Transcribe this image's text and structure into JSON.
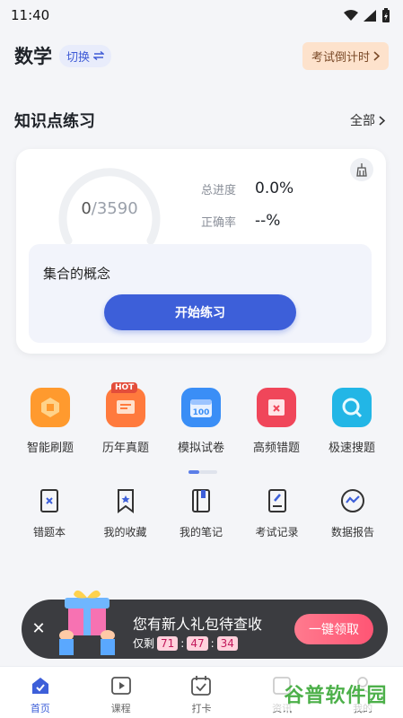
{
  "status_bar": {
    "time": "11:40"
  },
  "header": {
    "subject": "数学",
    "switch_label": "切换",
    "countdown_label": "考试倒计时"
  },
  "section": {
    "title": "知识点练习",
    "more_label": "全部"
  },
  "progress_card": {
    "done": "0",
    "total": "/3590",
    "done_fraction": 0,
    "total_progress_label": "总进度",
    "total_progress_value": "0.0%",
    "accuracy_label": "正确率",
    "accuracy_value": "--%",
    "knowledge_point": "集合的概念",
    "start_button": "开始练习"
  },
  "features": [
    {
      "label": "智能刷题",
      "icon": "smart-practice-icon",
      "color": "#ff9a2e"
    },
    {
      "label": "历年真题",
      "icon": "past-exams-icon",
      "color": "#ff7a3d",
      "badge": "HOT"
    },
    {
      "label": "模拟试卷",
      "icon": "mock-paper-icon",
      "color": "#3a8ef6"
    },
    {
      "label": "高频错题",
      "icon": "frequent-mistakes-icon",
      "color": "#f0465a"
    },
    {
      "label": "极速搜题",
      "icon": "quick-search-icon",
      "color": "#22b6e6"
    }
  ],
  "tools": [
    {
      "label": "错题本",
      "icon": "mistake-book-icon"
    },
    {
      "label": "我的收藏",
      "icon": "favorites-icon"
    },
    {
      "label": "我的笔记",
      "icon": "notes-icon"
    },
    {
      "label": "考试记录",
      "icon": "exam-record-icon"
    },
    {
      "label": "数据报告",
      "icon": "data-report-icon"
    }
  ],
  "promo": {
    "title": "您有新人礼包待查收",
    "remaining_label": "仅剩",
    "hours": "71",
    "minutes": "47",
    "seconds": "34",
    "claim_button": "一键领取"
  },
  "tabbar": [
    {
      "label": "首页",
      "icon": "home-icon",
      "active": true
    },
    {
      "label": "课程",
      "icon": "course-icon",
      "active": false
    },
    {
      "label": "打卡",
      "icon": "checkin-icon",
      "active": false
    },
    {
      "label": "资讯",
      "icon": "news-icon",
      "active": false
    },
    {
      "label": "我的",
      "icon": "profile-icon",
      "active": false
    }
  ],
  "watermark": "谷普软件园",
  "colors": {
    "accent": "#3d5fd9",
    "promo_bg": "#3b3c40",
    "claim": "#ff5574"
  }
}
